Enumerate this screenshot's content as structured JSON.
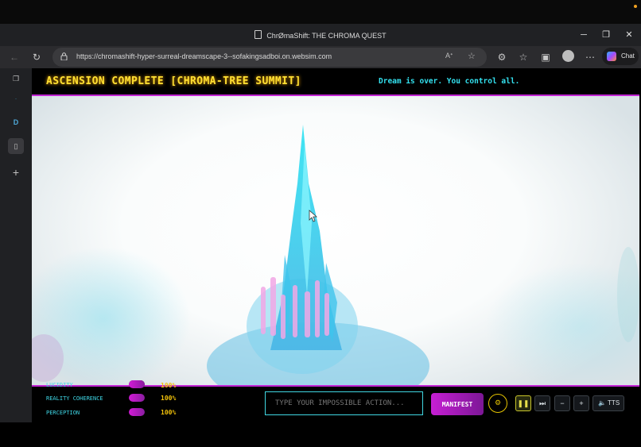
{
  "window": {
    "title": "ChrØmaShift: THE CHROMA QUEST"
  },
  "browser": {
    "url": "https://chromashift-hyper-surreal-dreamscape-3--sofakingsadboi.on.websim.com",
    "chat_label": "Chat",
    "sidebar_letter": "D"
  },
  "game": {
    "header_title": "ASCENSION COMPLETE [CHROMA-TREE SUMMIT]",
    "header_subtitle": "Dream is over. You control all.",
    "stats": [
      {
        "label": "LUCIDITY",
        "value": "100%",
        "fill": 1.0
      },
      {
        "label": "REALITY COHERENCE",
        "value": "100%",
        "fill": 1.0
      },
      {
        "label": "PERCEPTION",
        "value": "100%",
        "fill": 1.0
      }
    ],
    "action_placeholder": "TYPE YOUR IMPOSSIBLE ACTION...",
    "manifest_label": "MANIFEST",
    "tts_label": "TTS"
  },
  "colors": {
    "accent_magenta": "#c224d4",
    "accent_cyan": "#40d7e2",
    "accent_yellow": "#ffe033"
  }
}
